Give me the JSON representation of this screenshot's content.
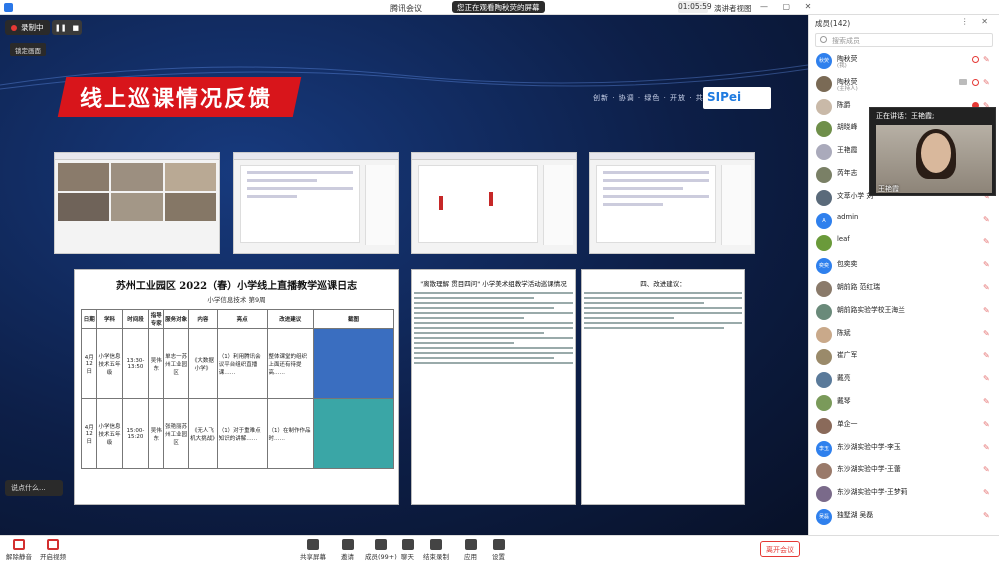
{
  "titlebar": {
    "title": "腾讯会议",
    "share_info": "您正在观看陶秋荧的屏幕",
    "timer": "01:05:59",
    "view_mode": "演讲者视图"
  },
  "recording": {
    "label": "录制中"
  },
  "lock_label": "锁定画面",
  "slide": {
    "heading": "线上巡课情况反馈",
    "tagline": "创新 · 协调 · 绿色 · 开放 · 共享",
    "logo_text": "SIPei",
    "doc_title": "苏州工业园区 2022（春）小学线上直播教学巡课日志",
    "doc_subtitle": "小学信息技术  第9周",
    "table_headers": [
      "日期",
      "学科",
      "时间段",
      "指导专家",
      "服务对象",
      "内容",
      "亮点",
      "改进建议",
      "截图"
    ],
    "row1": [
      "4月12日",
      "小学信息技术五年级",
      "13:30-13:50",
      "吴伟东",
      "单志一苏州工业园区",
      "《大数据小学》",
      "（1）利用腾讯会议平台组织直播课……",
      "整体课堂的组织上面还有待提高……"
    ],
    "row2": [
      "4月12日",
      "小学信息技术五年级",
      "15:00-15:20",
      "吴伟东",
      "张艳丽苏州工业园区",
      "《无人飞机大挑战》",
      "（1）对于重难点知识的讲解……",
      "（1）在制作作品时……"
    ],
    "mid_heading": "\"离散理解 贯目四问\" 小学美术组教学活动巡课情况",
    "right_heading": "四、改进建议："
  },
  "chat_placeholder": "说点什么...",
  "speaker": {
    "label": "正在讲话：王艳霞;",
    "name": "王艳霞"
  },
  "panel": {
    "title": "成员(142)",
    "search_placeholder": "搜索成员",
    "members": [
      {
        "name": "陶秋荧",
        "role": "(我)",
        "avatar": "秋荧",
        "color": "#2f80ed"
      },
      {
        "name": "陶秋荧",
        "role": "(主持人)",
        "avatar": "",
        "color": "#7a6a55"
      },
      {
        "name": "陈爵",
        "role": "",
        "avatar": "",
        "color": "#c9b9a8"
      },
      {
        "name": "胡晓峰",
        "role": "",
        "avatar": "",
        "color": "#6f8f4a"
      },
      {
        "name": "王艳霞",
        "role": "",
        "avatar": "",
        "color": "#aab"
      },
      {
        "name": "芮年志",
        "role": "",
        "avatar": "",
        "color": "#7a8066"
      },
      {
        "name": "文萃小学 刘",
        "role": "",
        "avatar": "",
        "color": "#5a6a7a"
      },
      {
        "name": "admin",
        "role": "",
        "avatar": "A",
        "color": "#2f80ed"
      },
      {
        "name": "leaf",
        "role": "",
        "avatar": "",
        "color": "#6a9a3a"
      },
      {
        "name": "包奕奕",
        "role": "",
        "avatar": "奕奕",
        "color": "#2f80ed"
      },
      {
        "name": "朝前路 范红瑞",
        "role": "",
        "avatar": "",
        "color": "#8a7a6a"
      },
      {
        "name": "朝前路实验学校王海兰",
        "role": "",
        "avatar": "",
        "color": "#6a8a7a"
      },
      {
        "name": "陈斌",
        "role": "",
        "avatar": "",
        "color": "#c9a98a"
      },
      {
        "name": "崔广军",
        "role": "",
        "avatar": "",
        "color": "#9a8a6a"
      },
      {
        "name": "戴亮",
        "role": "",
        "avatar": "",
        "color": "#5a7a9a"
      },
      {
        "name": "戴琴",
        "role": "",
        "avatar": "",
        "color": "#7a9a5a"
      },
      {
        "name": "单企一",
        "role": "",
        "avatar": "",
        "color": "#8a6a5a"
      },
      {
        "name": "东沙湖实验中学-李玉",
        "role": "",
        "avatar": "李玉",
        "color": "#2f80ed"
      },
      {
        "name": "东沙湖实验中学-王蕾",
        "role": "",
        "avatar": "",
        "color": "#9a7a6a"
      },
      {
        "name": "东沙湖实验中学-王梦莉",
        "role": "",
        "avatar": "",
        "color": "#7a6a8a"
      },
      {
        "name": "独墅湖 吴磊",
        "role": "",
        "avatar": "吴磊",
        "color": "#2f80ed"
      }
    ]
  },
  "toolbar": {
    "mute": "解除静音",
    "video": "开启视频",
    "share": "共享屏幕",
    "invite": "邀请",
    "members": "成员(99+)",
    "chat": "聊天",
    "record": "结束录制",
    "apps": "应用",
    "settings": "设置",
    "leave": "离开会议"
  }
}
